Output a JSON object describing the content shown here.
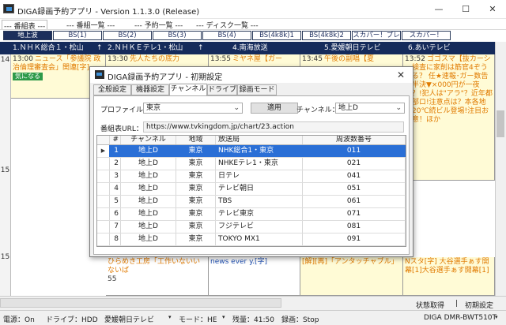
{
  "window": {
    "title": "DIGA録画予約アプリ - Version 1.1.3.0 (Release)",
    "minimize": "—",
    "maximize": "☐",
    "close": "✕"
  },
  "main_tabs": [
    "--- 番組表 ---",
    "--- 番組一覧 ---",
    "--- 予約一覧 ---",
    "--- ディスク一覧 ---"
  ],
  "channel_tabs": [
    "地上波",
    "BS(1)",
    "BS(2)",
    "BS(3)",
    "BS(4)",
    "BS(4k8k)1",
    "BS(4k8k)2",
    "スカパー！プレ",
    "スカパー！"
  ],
  "stations": [
    {
      "label": "1.ＮＨＫ総合１・松山",
      "arrow": "↑"
    },
    {
      "label": "2.ＮＨＫＥテレ1・松山",
      "arrow": "↑"
    },
    {
      "label": "4.南海放送",
      "arrow": ""
    },
    {
      "label": "5.愛媛朝日テレビ",
      "arrow": ""
    },
    {
      "label": "6.あいテレビ",
      "arrow": ""
    }
  ],
  "hours": [
    "14",
    "15",
    "15"
  ],
  "programs": {
    "c1_top": {
      "time": "13:00",
      "title": "ニュース「参議院 政治倫理審査会」関連[字]",
      "badge": "気になる"
    },
    "c2_top": {
      "time": "13:30",
      "title": "先人たちの底力"
    },
    "c3_top": {
      "time": "13:55",
      "title": "ミヤネ屋【ガー"
    },
    "c4_top": {
      "time": "13:45",
      "title": "午後の副唱【夏"
    },
    "c5_top": {
      "time": "13:52",
      "title": "ゴゴスマ【抜カーシー検査に家削は筋官4ぞうなる？ 任★速報･ガー数告に半決▼×000円が一夜で？!犯人は\"アラ\"？近年都市部ロ!注意点は？本各地で20℃続ビル登場!注目お室意！ほか"
    },
    "c2_bottom": {
      "time": "",
      "title": "ひらめき工房「工作いないいないば"
    },
    "c2_bottom_num": "55",
    "c3_bottom": {
      "title": "news ever y.[字]"
    },
    "c4_bottom": {
      "title": "[解][再]「アンタッチャブル」"
    },
    "c5_bottom": {
      "time": "50",
      "title": "Nスタ[字] 大谷選手ぁす開幕[1]大谷選手ぁす開幕[1]"
    }
  },
  "dialog": {
    "title": "DIGA録画予約アプリ - 初期設定",
    "close": "✕",
    "tabs": [
      "全般設定",
      "機器設定",
      "チャンネル",
      "ドライブ",
      "録画モード"
    ],
    "profile_label": "プロファイル：",
    "profile_value": "東京",
    "apply_button": "適用",
    "channel_label": "チャンネル：",
    "channel_value": "地上D",
    "url_label": "番組表URL：",
    "url_value": "https://www.tvkingdom.jp/chart/23.action",
    "table": {
      "headers": [
        "#",
        "チャンネル",
        "地域",
        "放送局",
        "周波数番号"
      ],
      "rows": [
        [
          "1",
          "地上D",
          "東京",
          "NHK総合1・東京",
          "011"
        ],
        [
          "2",
          "地上D",
          "東京",
          "NHKEテレ1・東京",
          "021"
        ],
        [
          "3",
          "地上D",
          "東京",
          "日テレ",
          "041"
        ],
        [
          "4",
          "地上D",
          "東京",
          "テレビ朝日",
          "051"
        ],
        [
          "5",
          "地上D",
          "東京",
          "TBS",
          "061"
        ],
        [
          "6",
          "地上D",
          "東京",
          "テレビ東京",
          "071"
        ],
        [
          "7",
          "地上D",
          "東京",
          "フジテレビ",
          "081"
        ],
        [
          "8",
          "地上D",
          "東京",
          "TOKYO MX1",
          "091"
        ]
      ]
    }
  },
  "links": {
    "status": "状態取得",
    "settings": "初期設定",
    "sep": "|"
  },
  "status_bar": {
    "power": "電源：On",
    "drive": "ドライブ：HDD",
    "station": "愛媛朝日テレビ",
    "mode": "モード：HE",
    "remaining": "残量：41:50",
    "recording": "録画：Stop",
    "device": "DIGA DMR-BWT510T"
  },
  "colors": {
    "header_bg": "#152b5b",
    "selected_row": "#2a6fd6",
    "badge": "#2e9a4a",
    "program_title": "#e07a00"
  }
}
